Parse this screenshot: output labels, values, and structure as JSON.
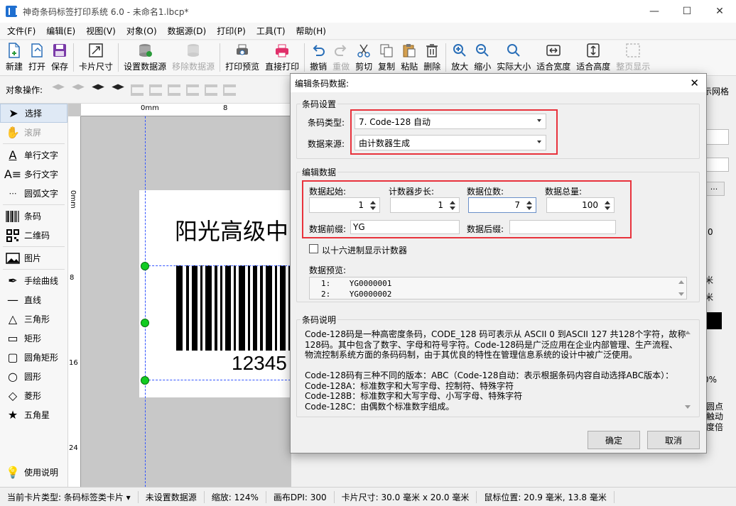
{
  "window": {
    "title": "神奇条码标签打印系统 6.0 - 未命名1.lbcp*"
  },
  "menu": [
    "文件(F)",
    "编辑(E)",
    "视图(V)",
    "对象(O)",
    "数据源(D)",
    "打印(P)",
    "工具(T)",
    "帮助(H)"
  ],
  "toolbar": [
    {
      "label": "新建",
      "icon": "new-file-icon"
    },
    {
      "label": "打开",
      "icon": "open-icon"
    },
    {
      "label": "保存",
      "icon": "save-icon"
    },
    {
      "label": "卡片尺寸",
      "icon": "card-size-icon"
    },
    {
      "label": "设置数据源",
      "icon": "database-icon"
    },
    {
      "label": "移除数据源",
      "icon": "database-remove-icon"
    },
    {
      "label": "打印预览",
      "icon": "print-preview-icon"
    },
    {
      "label": "直接打印",
      "icon": "print-icon"
    },
    {
      "label": "撤销",
      "icon": "undo-icon"
    },
    {
      "label": "重做",
      "icon": "redo-icon"
    },
    {
      "label": "剪切",
      "icon": "cut-icon"
    },
    {
      "label": "复制",
      "icon": "copy-icon"
    },
    {
      "label": "粘贴",
      "icon": "paste-icon"
    },
    {
      "label": "删除",
      "icon": "delete-icon"
    },
    {
      "label": "放大",
      "icon": "zoom-in-icon"
    },
    {
      "label": "缩小",
      "icon": "zoom-out-icon"
    },
    {
      "label": "实际大小",
      "icon": "actual-size-icon"
    },
    {
      "label": "适合宽度",
      "icon": "fit-width-icon"
    },
    {
      "label": "适合高度",
      "icon": "fit-height-icon"
    },
    {
      "label": "整页显示",
      "icon": "fit-page-icon"
    }
  ],
  "objbar": {
    "label": "对象操作:"
  },
  "tools": [
    {
      "label": "选择",
      "icon": "cursor-icon"
    },
    {
      "label": "滚屏",
      "icon": "hand-icon"
    },
    {
      "label": "单行文字",
      "icon": "text-single-icon"
    },
    {
      "label": "多行文字",
      "icon": "text-multi-icon"
    },
    {
      "label": "圆弧文字",
      "icon": "text-arc-icon"
    },
    {
      "label": "条码",
      "icon": "barcode-icon"
    },
    {
      "label": "二维码",
      "icon": "qrcode-icon"
    },
    {
      "label": "图片",
      "icon": "image-icon"
    },
    {
      "label": "手绘曲线",
      "icon": "pen-icon"
    },
    {
      "label": "直线",
      "icon": "line-icon"
    },
    {
      "label": "三角形",
      "icon": "triangle-icon"
    },
    {
      "label": "矩形",
      "icon": "rectangle-icon"
    },
    {
      "label": "圆角矩形",
      "icon": "rounded-rect-icon"
    },
    {
      "label": "圆形",
      "icon": "circle-icon"
    },
    {
      "label": "菱形",
      "icon": "diamond-icon"
    },
    {
      "label": "五角星",
      "icon": "star-icon"
    }
  ],
  "help": {
    "label": "使用说明"
  },
  "canvas": {
    "ruler_top": [
      "0mm",
      "8"
    ],
    "ruler_left": [
      "0mm",
      "8",
      "16",
      "24"
    ],
    "label_text": "阳光高级中",
    "barcode_number": "12345"
  },
  "right_fragments": [
    "示网格",
    "0",
    "米",
    "米",
    "0%",
    "圆点",
    "触动",
    "度倍"
  ],
  "status": [
    "当前卡片类型: 条码标签类卡片 ▾",
    "未设置数据源",
    "缩放: 124%",
    "画布DPI: 300",
    "卡片尺寸: 30.0 毫米 x 20.0 毫米",
    "鼠标位置: 20.9 毫米, 13.8 毫米"
  ],
  "dialog": {
    "title": "编辑条码数据:",
    "barcode_settings": {
      "title": "条码设置",
      "type_label": "条码类型:",
      "type_value": "7. Code-128 自动",
      "source_label": "数据来源:",
      "source_value": "由计数器生成"
    },
    "edit_data": {
      "title": "编辑数据",
      "start_label": "数据起始:",
      "start_value": "1",
      "step_label": "计数器步长:",
      "step_value": "1",
      "digits_label": "数据位数:",
      "digits_value": "7",
      "total_label": "数据总量:",
      "total_value": "100",
      "prefix_label": "数据前缀:",
      "prefix_value": "YG",
      "suffix_label": "数据后缀:",
      "suffix_value": "",
      "hex_label": "以十六进制显示计数器",
      "preview_label": "数据预览:",
      "preview": [
        "1:    YG0000001",
        "2:    YG0000002"
      ]
    },
    "description": {
      "title": "条码说明",
      "lines": [
        "Code-128码是一种高密度条码，CODE_128 码可表示从 ASCII 0 到ASCII 127 共128个字符，故称",
        "128码。其中包含了数字、字母和符号字符。Code-128码是广泛应用在企业内部管理、生产流程、",
        "物流控制系统方面的条码码制，由于其优良的特性在管理信息系统的设计中被广泛使用。",
        "",
        "Code-128码有三种不同的版本：ABC（Code-128自动：表示根据条码内容自动选择ABC版本）：",
        "Code-128A：标准数字和大写字母、控制符、特殊字符",
        "Code-128B：标准数字和大写字母、小写字母、特殊字符",
        "Code-128C：由偶数个标准数字组成。"
      ]
    },
    "ok": "确定",
    "cancel": "取消"
  },
  "colors": {
    "highlight_red": "#e8323c",
    "handle_green": "#11cc22"
  }
}
